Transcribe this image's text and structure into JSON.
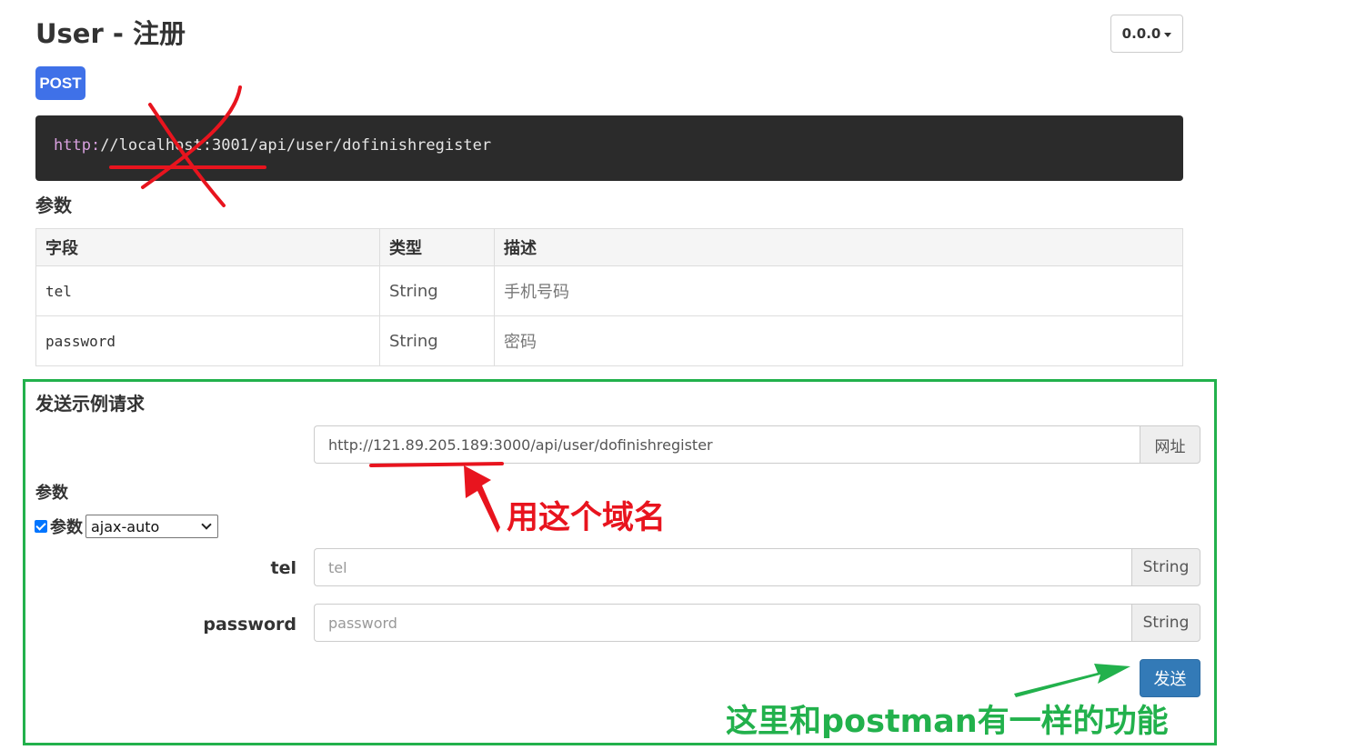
{
  "header": {
    "title": "User - 注册",
    "version": "0.0.0"
  },
  "endpoint": {
    "method": "POST",
    "url_protocol": "http:",
    "url_rest": "//localhost:3001/api/user/dofinishregister"
  },
  "params_section": {
    "title": "参数",
    "columns": [
      "字段",
      "类型",
      "描述"
    ],
    "rows": [
      {
        "field": "tel",
        "type": "String",
        "description": "手机号码"
      },
      {
        "field": "password",
        "type": "String",
        "description": "密码"
      }
    ]
  },
  "sample_request": {
    "title": "发送示例请求",
    "url_value": "http://121.89.205.189:3000/api/user/dofinishregister",
    "url_addon": "网址",
    "params_title": "参数",
    "params_checkbox_label": "参数",
    "params_checked": true,
    "params_mode": "ajax-auto",
    "fields": [
      {
        "label": "tel",
        "placeholder": "tel",
        "type": "String"
      },
      {
        "label": "password",
        "placeholder": "password",
        "type": "String"
      }
    ],
    "send_label": "发送"
  },
  "annotations": {
    "red_note": "用这个域名",
    "green_note": "这里和postman有一样的功能",
    "red_color": "#e8141e",
    "green_color": "#22b14c"
  }
}
